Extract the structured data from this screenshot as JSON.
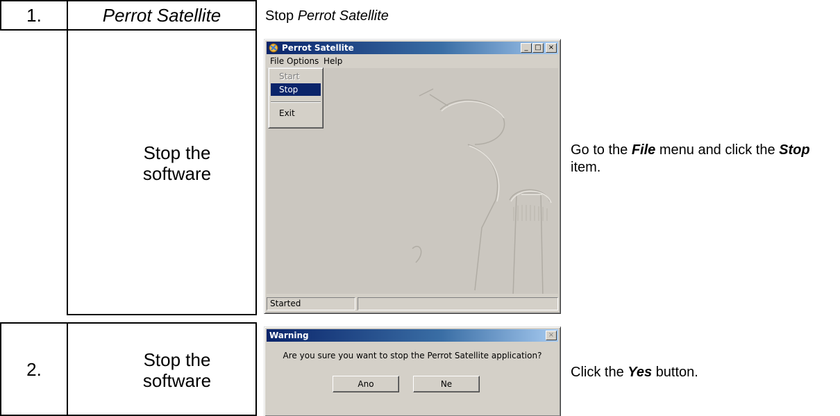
{
  "steps": [
    {
      "number": "1.",
      "app_name": "Perrot Satellite",
      "task": "Stop the software",
      "caption_prefix": "Stop ",
      "caption_app": "Perrot Satellite",
      "instruction": {
        "part1": "Go to the ",
        "bold1": "File",
        "part2": " menu and click the ",
        "bold2": "Stop",
        "part3": " item."
      }
    },
    {
      "number": "2.",
      "task": "Stop the software",
      "instruction": {
        "part1": "Click the ",
        "bold1": "Yes",
        "part2": " button."
      }
    }
  ],
  "app_window": {
    "title": "Perrot Satellite",
    "controls": {
      "minimize": "_",
      "maximize": "□",
      "close": "×"
    },
    "menu": [
      "File",
      "Options",
      "Help"
    ],
    "file_menu_items": [
      {
        "label": "Start",
        "state": "disabled"
      },
      {
        "label": "Stop",
        "state": "selected"
      },
      {
        "label": "Exit",
        "state": "normal"
      }
    ],
    "status_text": "Started",
    "icon": "satellite-app-icon"
  },
  "dialog": {
    "title": "Warning",
    "message": "Are you sure you want to stop the Perrot Satellite application?",
    "buttons": [
      "Ano",
      "Ne"
    ],
    "close_glyph": "×"
  },
  "colors": {
    "title_active": "#0a246a",
    "title_gradient_end": "#a6caf0",
    "face": "#d4d0c8",
    "menu_highlight": "#0a246a"
  }
}
